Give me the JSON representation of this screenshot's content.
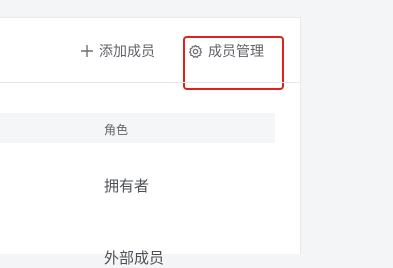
{
  "toolbar": {
    "add_member_label": "添加成员",
    "manage_members_label": "成员管理"
  },
  "table": {
    "columns": [
      "角色"
    ],
    "rows": [
      {
        "role": "拥有者"
      },
      {
        "role": "外部成员"
      }
    ]
  },
  "colors": {
    "highlight": "#e0201a",
    "text": "#5f6368",
    "header_bg": "#f5f6f8"
  },
  "icons": {
    "add": "plus-icon",
    "manage": "gear-icon"
  }
}
